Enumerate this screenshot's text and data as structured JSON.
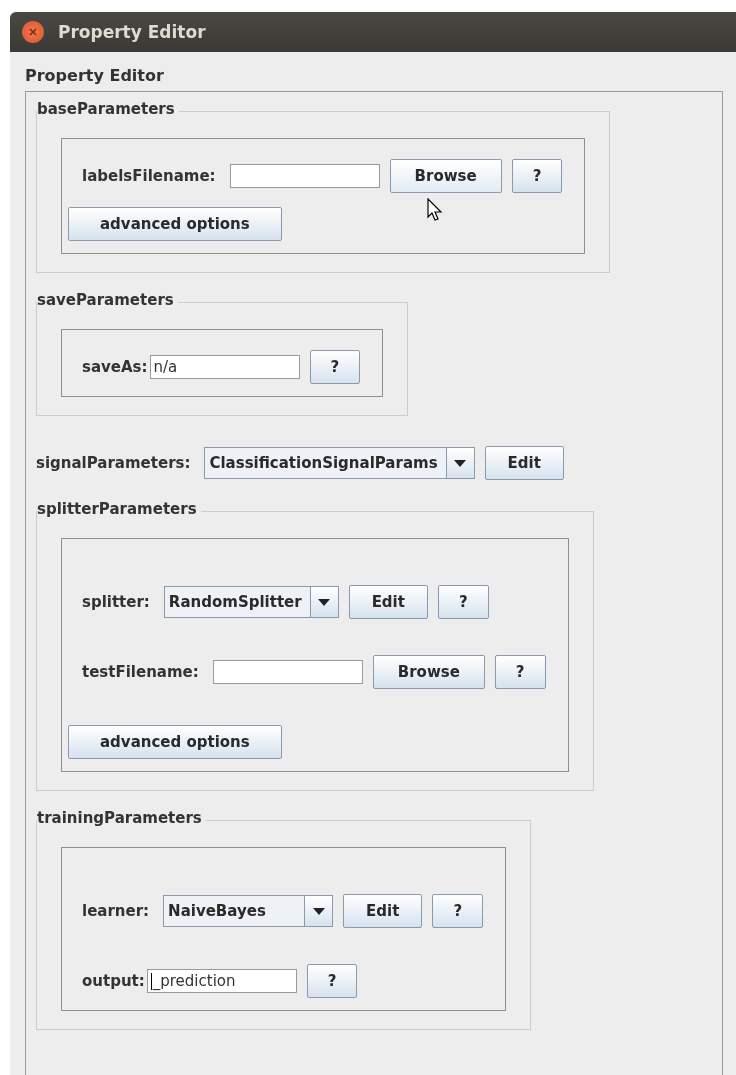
{
  "window": {
    "title": "Property Editor"
  },
  "panel": {
    "title": "Property Editor"
  },
  "sections": [
    {
      "kind": "group",
      "title": "baseParameters",
      "rows": [
        {
          "kind": "file",
          "label": "labelsFilename:",
          "browse": {
            "label": "Browse",
            "hovered": true
          },
          "help": "?"
        },
        {
          "kind": "button",
          "label": "advanced options"
        }
      ]
    },
    {
      "kind": "group",
      "title": "saveParameters",
      "rows": [
        {
          "kind": "text",
          "label": "saveAs:",
          "value": "n/a",
          "help": "?"
        }
      ]
    },
    {
      "kind": "row",
      "row": {
        "kind": "choice",
        "label": "signalParameters:",
        "value": "ClassificationSignalParams",
        "edit": "Edit"
      }
    },
    {
      "kind": "group",
      "title": "splitterParameters",
      "rows": [
        {
          "kind": "choice",
          "label": "splitter:",
          "value": "RandomSplitter",
          "edit": "Edit",
          "help": "?"
        },
        {
          "kind": "file",
          "label": "testFilename:",
          "browse": {
            "label": "Browse",
            "hovered": false
          },
          "help": "?"
        },
        {
          "kind": "button",
          "label": "advanced options"
        }
      ]
    },
    {
      "kind": "group",
      "title": "trainingParameters",
      "rows": [
        {
          "kind": "choice",
          "label": "learner:",
          "value": "NaiveBayes",
          "edit": "Edit",
          "help": "?"
        },
        {
          "kind": "text",
          "label": "output:",
          "value": "_prediction",
          "focused": true,
          "help": "?"
        }
      ]
    }
  ]
}
